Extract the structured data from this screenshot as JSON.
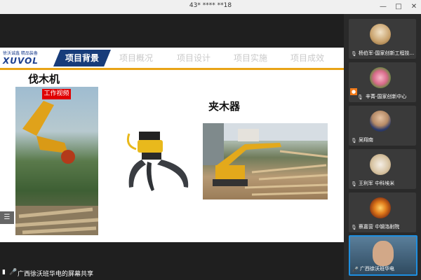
{
  "window": {
    "title": "43* **** **18",
    "controls": [
      "—",
      "□",
      "✕"
    ]
  },
  "slide": {
    "logo_tag": "徐沃诚鑫 精品装备",
    "logo_text": "XUVOL",
    "active_tab": "项目背景",
    "tabs": [
      "项目概况",
      "项目设计",
      "项目实施",
      "项目成效"
    ],
    "section1_title": "伐木机",
    "video_label": "工作视频",
    "section2_title": "夹木器"
  },
  "share_bar": {
    "label": "广西徐沃班华电的屏幕共享"
  },
  "participants": [
    {
      "name": "杨伯军-国家创新工程技...",
      "muted": true
    },
    {
      "name": "辛菁-国家创新中心",
      "muted": true
    },
    {
      "name": "吴翔南",
      "muted": true
    },
    {
      "name": "王利军 中科埃米",
      "muted": true
    },
    {
      "name": "蔡嘉营 中钢洛耐院",
      "muted": true
    },
    {
      "name": "广西徐沃班华电",
      "muted": false
    }
  ],
  "colors": {
    "accent_blue": "#173c7a",
    "header_line": "#e8a316",
    "video_label_bg": "#e00000",
    "active_border": "#1e8fe0"
  }
}
